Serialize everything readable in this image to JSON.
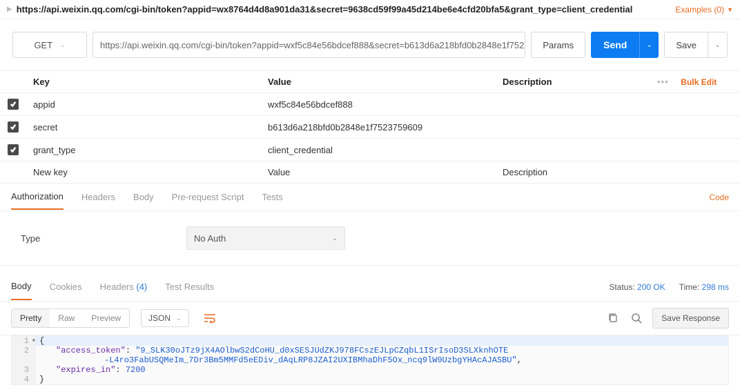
{
  "header": {
    "url_text": "https://api.weixin.qq.com/cgi-bin/token?appid=wx8764d4d8a901da31&secret=9638cd59f99a45d214be6e4cfd20bfa5&grant_type=client_credential",
    "examples_label": "Examples (0)"
  },
  "request": {
    "method": "GET",
    "url": "https://api.weixin.qq.com/cgi-bin/token?appid=wxf5c84e56bdcef888&secret=b613d6a218bfd0b2848e1f752375...",
    "params_btn": "Params",
    "send_btn": "Send",
    "save_btn": "Save"
  },
  "params": {
    "col_key": "Key",
    "col_value": "Value",
    "col_desc": "Description",
    "bulk_edit": "Bulk Edit",
    "rows": [
      {
        "key": "appid",
        "value": "wxf5c84e56bdcef888",
        "desc": ""
      },
      {
        "key": "secret",
        "value": "b613d6a218bfd0b2848e1f7523759609",
        "desc": ""
      },
      {
        "key": "grant_type",
        "value": "client_credential",
        "desc": ""
      }
    ],
    "nrow": {
      "key": "New key",
      "value": "Value",
      "desc": "Description"
    }
  },
  "tabs_lower": {
    "authorization": "Authorization",
    "headers": "Headers",
    "body": "Body",
    "prereq": "Pre-request Script",
    "tests": "Tests",
    "code_link": "Code"
  },
  "auth": {
    "type_label": "Type",
    "type_value": "No Auth"
  },
  "resp_tabs": {
    "body": "Body",
    "cookies": "Cookies",
    "headers": "Headers",
    "headers_count": "(4)",
    "tests": "Test Results"
  },
  "resp_meta": {
    "status_label": "Status:",
    "status_value": "200 OK",
    "time_label": "Time:",
    "time_value": "298 ms"
  },
  "resp_toolbar": {
    "pretty": "Pretty",
    "raw": "Raw",
    "preview": "Preview",
    "format": "JSON",
    "save_resp": "Save Response"
  },
  "resp_body": {
    "access_token_key": "\"access_token\"",
    "access_token_val": "\"9_SLK30oJTz9jX4AOlbwS2dCoHU_d0xSESJUdZKJ978FCszEJLpCZqbL1ISrIsoD3SLXknhOTE",
    "access_token_cont": "-L4ro3FabUSQMeIm_7Dr3Bm5MMFd5eEDiv_dAqLRP8JZAI2UXIBMhaDhF5Ox_ncq9lW9UzbgYHAcAJASBU\"",
    "expires_key": "\"expires_in\"",
    "expires_val": "7200"
  }
}
